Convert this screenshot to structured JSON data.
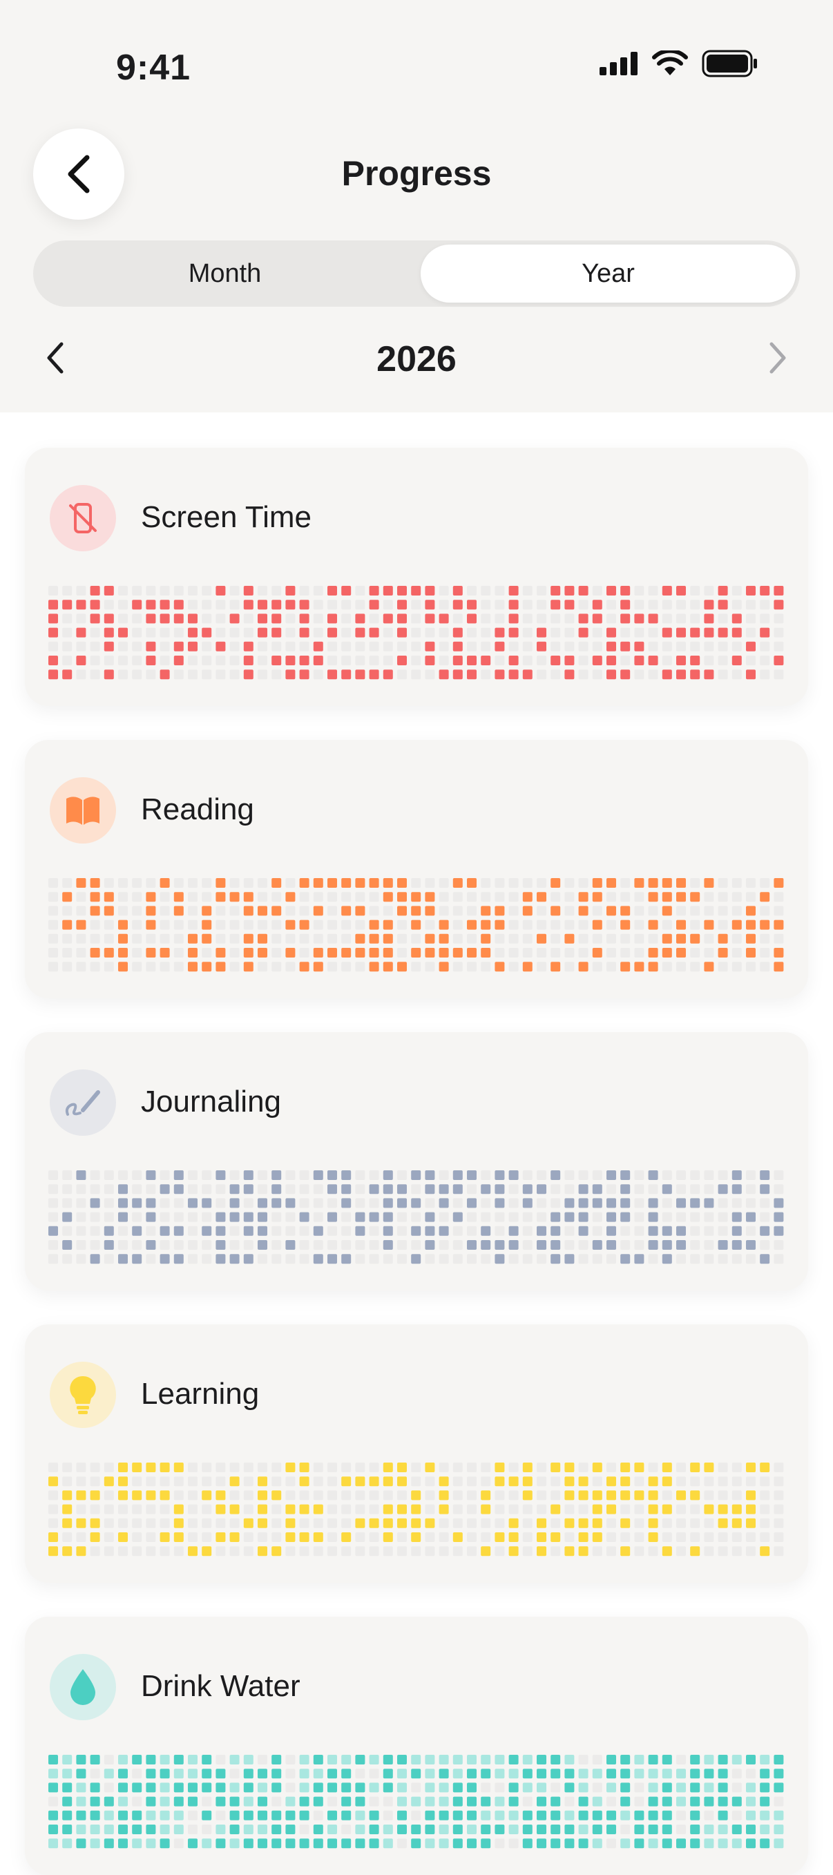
{
  "status": {
    "time": "9:41"
  },
  "header": {
    "title": "Progress"
  },
  "segmented": {
    "month_label": "Month",
    "year_label": "Year",
    "selected": "Year"
  },
  "year_nav": {
    "year": "2026"
  },
  "habits": [
    {
      "name": "Screen Time",
      "icon": "phone-off-icon",
      "color": "#f46565",
      "empty": "#ecebea",
      "bg": "#fadcdc",
      "seed": 11,
      "density": 0.45
    },
    {
      "name": "Reading",
      "icon": "book-icon",
      "color": "#ff8b4a",
      "empty": "#ecebea",
      "bg": "#fde1d0",
      "seed": 23,
      "density": 0.42
    },
    {
      "name": "Journaling",
      "icon": "pen-icon",
      "color": "#9ba7bf",
      "empty": "#ecebea",
      "bg": "#e6e7eb",
      "seed": 37,
      "density": 0.45
    },
    {
      "name": "Learning",
      "icon": "lightbulb-icon",
      "color": "#fcd93e",
      "empty": "#ecebea",
      "bg": "#fbefcc",
      "seed": 41,
      "density": 0.45
    },
    {
      "name": "Drink Water",
      "icon": "water-drop-icon",
      "color": "#4ccfc2",
      "empty": "#ecebea",
      "light": "#a9e7e0",
      "bg": "#d7efec",
      "seed": 53,
      "density": 0.5
    }
  ]
}
